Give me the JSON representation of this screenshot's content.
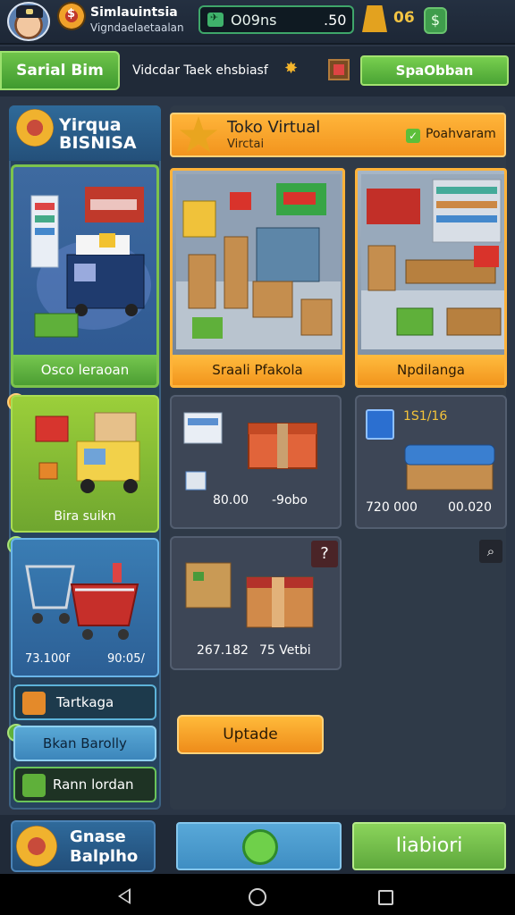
{
  "top_bar": {
    "title": "Simlauintsia",
    "subtitle": "Vigndaelaetaalan",
    "money_label": "O09ns",
    "money_value": ".50",
    "gold_value": "06"
  },
  "nav": {
    "left_button": "Sarial Bim",
    "center_text": "Vidcdar Taek ehsbiasf",
    "right_button": "SpaObban"
  },
  "brand": {
    "title": "Yirqua BISNISA"
  },
  "left_cards": [
    {
      "label": "Osco leraoan"
    },
    {
      "label": "Bira suikn"
    },
    {
      "value_left": "73.100f",
      "value_right": "90:05/"
    }
  ],
  "left_buttons": [
    {
      "label": "Tartkaga"
    },
    {
      "label": "Bkan Barolly"
    },
    {
      "label": "Rann lordan"
    }
  ],
  "main_header": {
    "title": "Toko Virtual",
    "subtitle": "Virctai",
    "right_label": "Poahvaram"
  },
  "stores": [
    {
      "button": "Sraali Pfakola"
    },
    {
      "button": "Npdilanga"
    }
  ],
  "items": [
    {
      "value_left": "80.00",
      "value_right": "-9obo"
    },
    {
      "badge": "1S1/16",
      "value_left": "720 000",
      "value_right": "00.020"
    },
    {
      "value_left": "267.182",
      "value_right": "75 Vetbi"
    }
  ],
  "update_button": "Uptade",
  "bottom_bar": {
    "left_title": "Gnase Balplho",
    "right_button": "Iiabiori"
  },
  "colors": {
    "accent_orange": "#f2941e",
    "accent_green": "#5ea83c",
    "panel_bg": "#2f3a48"
  }
}
